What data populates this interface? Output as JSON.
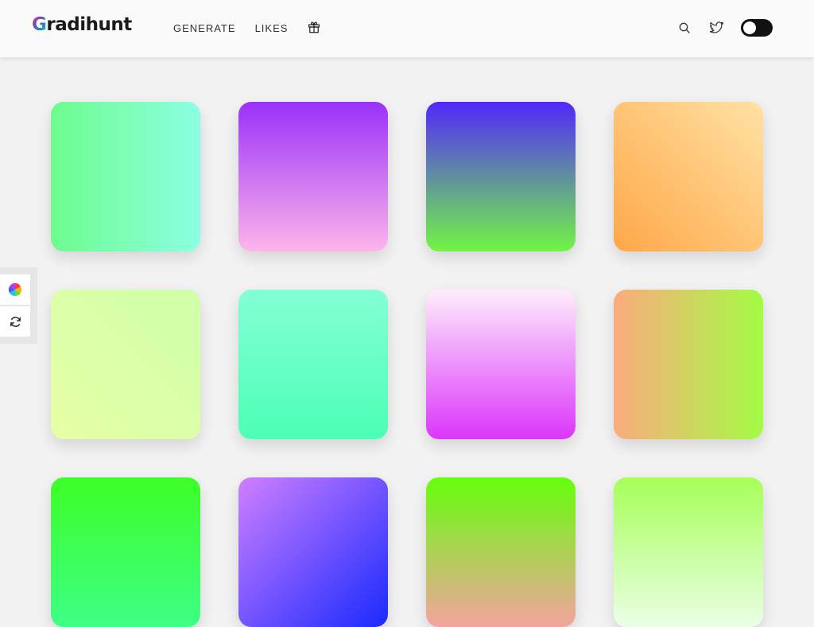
{
  "header": {
    "logo_first": "G",
    "logo_rest": "radihunt",
    "nav": {
      "generate": "GENERATE",
      "likes": "LIKES"
    },
    "icons": [
      "gift-icon",
      "search-icon",
      "twitter-icon",
      "dark-mode-toggle"
    ]
  },
  "side_tools": {
    "icons": [
      "color-wheel-icon",
      "refresh-icon"
    ]
  },
  "gradients": [
    {
      "angle": "90deg",
      "from": "#6dfc8f",
      "to": "#8bffe1"
    },
    {
      "angle": "180deg",
      "from": "#9b31fa",
      "to": "#fdb6ea"
    },
    {
      "angle": "180deg",
      "from": "#5228fa",
      "to": "#71f545"
    },
    {
      "angle": "45deg",
      "from": "#ffa748",
      "to": "#ffe2a4"
    },
    {
      "angle": "45deg",
      "from": "#e6ffa6",
      "to": "#cfffaa"
    },
    {
      "angle": "180deg",
      "from": "#84ffd5",
      "to": "#4bffb5"
    },
    {
      "angle": "180deg",
      "from": "#ffedfc",
      "to": "#db36fb"
    },
    {
      "angle": "90deg",
      "from": "#fbab7e",
      "to": "#a4fc44"
    },
    {
      "angle": "180deg",
      "from": "#3dff26",
      "to": "#3dff87"
    },
    {
      "angle": "135deg",
      "from": "#cf7fff",
      "to": "#192aff"
    },
    {
      "angle": "180deg",
      "from": "#66ff0a",
      "to": "#f3a39f"
    },
    {
      "angle": "180deg",
      "from": "#a6ff58",
      "to": "#eaffe6"
    }
  ]
}
